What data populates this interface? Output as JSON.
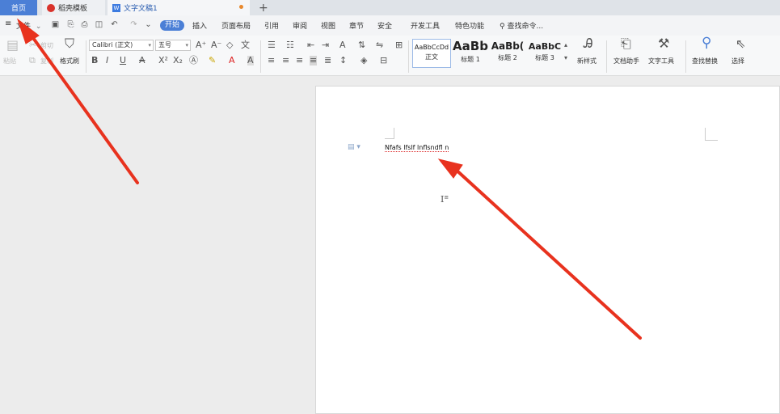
{
  "tabs": {
    "home": "首页",
    "template": "稻壳模板",
    "document": "文字文稿1",
    "add": "+"
  },
  "menu": {
    "file": "文件",
    "items": [
      "开始",
      "插入",
      "页面布局",
      "引用",
      "审阅",
      "视图",
      "章节",
      "安全",
      "开发工具",
      "特色功能"
    ],
    "search": "查找命令..."
  },
  "ribbon": {
    "paste": "粘贴",
    "cut": "剪切",
    "copy": "复制",
    "format_painter": "格式刷",
    "font_name": "Calibri (正文)",
    "font_size": "五号",
    "styles": [
      {
        "sample": "AaBbCcDd",
        "name": "正文"
      },
      {
        "sample": "AaBb",
        "name": "标题 1"
      },
      {
        "sample": "AaBb(",
        "name": "标题 2"
      },
      {
        "sample": "AaBbC",
        "name": "标题 3"
      }
    ],
    "new_style": "新样式",
    "doc_assistant": "文档助手",
    "text_tools": "文字工具",
    "find_replace": "查找替换",
    "select": "选择"
  },
  "document": {
    "text": "Nfafs lfslf lnflsndfl n"
  },
  "colors": {
    "accent": "#4b7fd6",
    "annotation_arrow": "#e8321e"
  }
}
